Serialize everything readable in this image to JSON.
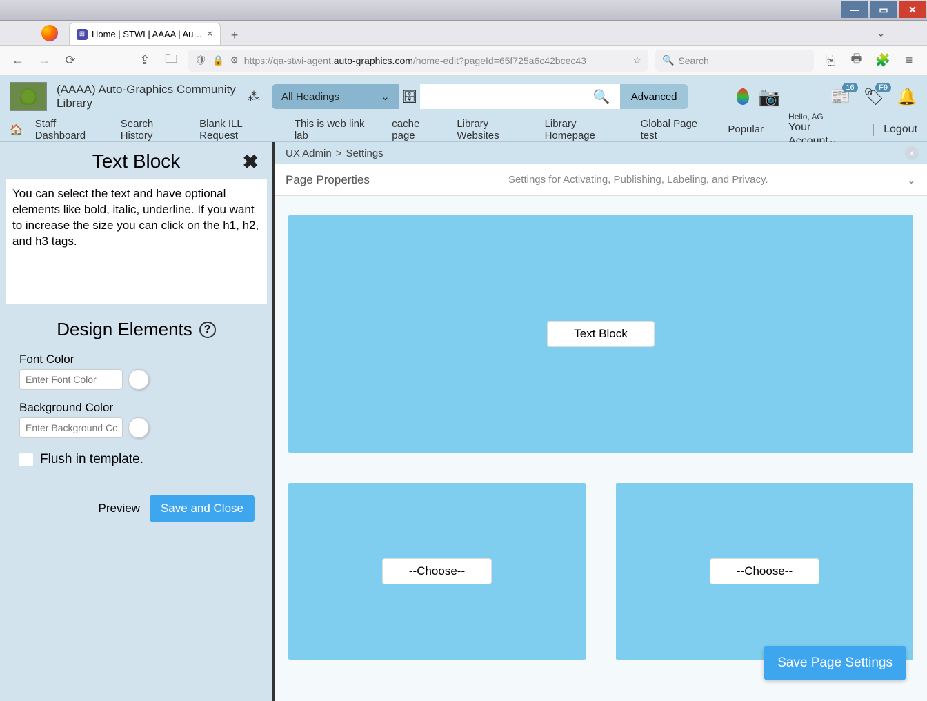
{
  "browser": {
    "tab_title": "Home | STWI | AAAA | Auto-Gr",
    "url_prefix": "https://qa-stwi-agent.",
    "url_domain": "auto-graphics.com",
    "url_path": "/home-edit?pageId=65f725a6c42bcec43",
    "search_placeholder": "Search"
  },
  "header": {
    "library_name": "(AAAA) Auto-Graphics Community Library",
    "headings_dd": "All Headings",
    "advanced": "Advanced",
    "badge1": "16",
    "badge2": "F9",
    "greeting": "Hello, AG",
    "account": "Your Account",
    "logout": "Logout"
  },
  "nav_items": [
    "Staff Dashboard",
    "Search History",
    "Blank ILL Request",
    "This is web link lab",
    "cache page",
    "Library Websites",
    "Library Homepage",
    "Global Page test",
    "Popular"
  ],
  "sidebar": {
    "title": "Text Block",
    "help_text": "You can select the text and have optional elements like bold, italic, underline. If you want to increase the size you can click on the h1, h2, and h3 tags.",
    "design_header": "Design Elements",
    "font_color_label": "Font Color",
    "font_color_placeholder": "Enter Font Color",
    "bg_color_label": "Background Color",
    "bg_color_placeholder": "Enter Background Color",
    "flush_label": "Flush in template.",
    "preview": "Preview",
    "save_close": "Save and Close"
  },
  "content": {
    "crumb1": "UX Admin",
    "crumb_sep": ">",
    "crumb2": "Settings",
    "prop_title": "Page Properties",
    "prop_sub": "Settings for Activating, Publishing, Labeling, and Privacy.",
    "block1_label": "Text Block",
    "block2_label": "--Choose--",
    "block3_label": "--Choose--",
    "save_page": "Save Page Settings"
  }
}
